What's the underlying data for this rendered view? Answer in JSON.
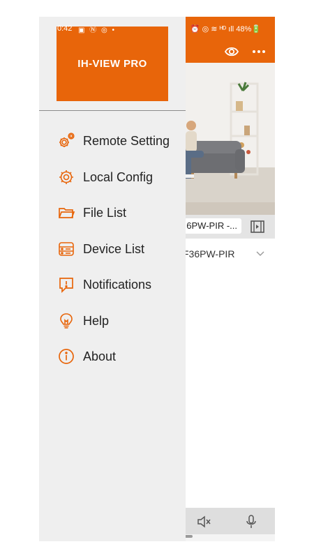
{
  "status_bar": {
    "time": "0:42",
    "left_icons": "▣ Ⓝ ◎ •",
    "right_text": "⏰ ◎ ≋ ᴴᴰ ıll 48%🔋"
  },
  "drawer": {
    "logo_text": "IH-VIEW PRO",
    "menu": [
      {
        "label": "Remote Setting",
        "icon": "gears-icon"
      },
      {
        "label": "Local Config",
        "icon": "gear-icon"
      },
      {
        "label": "File List",
        "icon": "folder-icon"
      },
      {
        "label": "Device List",
        "icon": "device-icon"
      },
      {
        "label": "Notifications",
        "icon": "notification-icon"
      },
      {
        "label": "Help",
        "icon": "lightbulb-icon"
      },
      {
        "label": "About",
        "icon": "info-icon"
      }
    ]
  },
  "background_app": {
    "channel_label": "6PW-PIR -...",
    "device_name": "F36PW-PIR"
  },
  "colors": {
    "accent": "#e8650a",
    "drawer_bg": "#efefef",
    "text": "#222222"
  }
}
